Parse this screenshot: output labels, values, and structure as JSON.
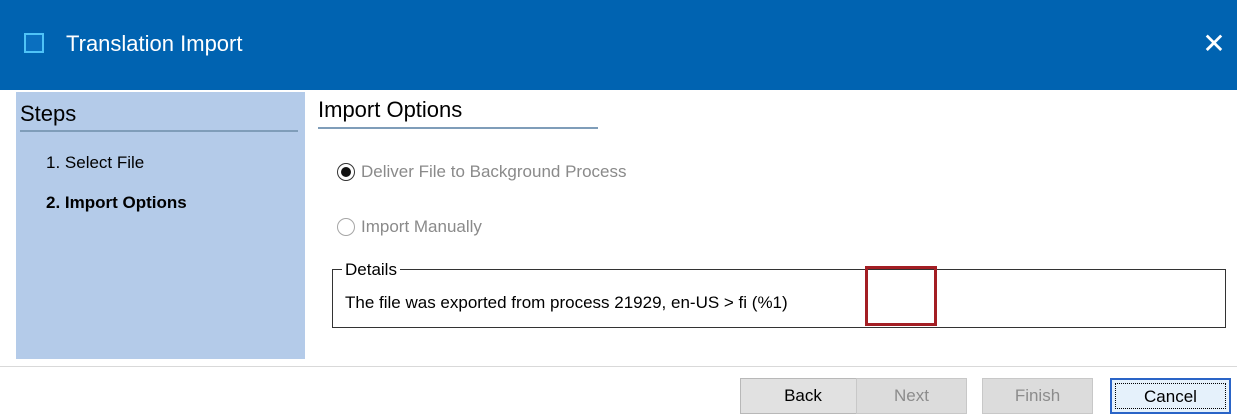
{
  "window": {
    "title": "Translation Import",
    "close_glyph": "✕"
  },
  "steps": {
    "heading": "Steps",
    "items": [
      "1. Select File",
      "2. Import Options"
    ],
    "active_index": 1
  },
  "import_options": {
    "heading": "Import Options",
    "radios": [
      {
        "label": "Deliver File to Background Process",
        "checked": true,
        "enabled": false
      },
      {
        "label": "Import Manually",
        "checked": false,
        "enabled": false
      }
    ]
  },
  "details": {
    "legend": "Details",
    "text": "The file was exported from process 21929, en-US > fi (%1)"
  },
  "buttons": {
    "back": {
      "label": "Back",
      "enabled": true
    },
    "next": {
      "label": "Next",
      "enabled": false
    },
    "finish": {
      "label": "Finish",
      "enabled": false
    },
    "cancel": {
      "label": "Cancel",
      "enabled": true,
      "focused": true
    }
  },
  "colors": {
    "titlebar": "#0063b1",
    "steps_panel": "#b4cbe9",
    "highlight": "#a31e23",
    "focus_border": "#2a64c7"
  }
}
